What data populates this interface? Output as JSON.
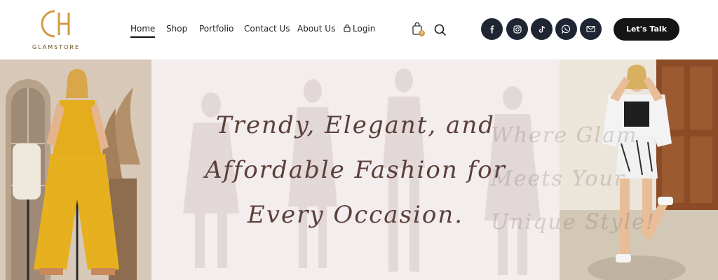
{
  "brand": {
    "logo_monogram": "CH",
    "name": "GLAMSTORE"
  },
  "nav": {
    "items": [
      "Home",
      "Shop",
      "Portfolio",
      "Contact Us",
      "About Us",
      "Login"
    ],
    "active": "Home"
  },
  "cart": {
    "count": "0"
  },
  "social": [
    "facebook-icon",
    "instagram-icon",
    "tiktok-icon",
    "whatsapp-icon",
    "mail-icon"
  ],
  "cta": {
    "label": "Let's Talk"
  },
  "hero": {
    "headline": [
      "Trendy, Elegant, and",
      "Affordable Fashion for",
      "Every Occasion."
    ],
    "tagline": [
      "Where Glam",
      "Meets Your",
      "Unique Style!"
    ]
  },
  "colors": {
    "brand_gold": "#d29a43",
    "dark": "#151515",
    "social_bg": "#1f2533",
    "headline": "#5a3f3a",
    "hero_bg": "#f3ecec"
  }
}
